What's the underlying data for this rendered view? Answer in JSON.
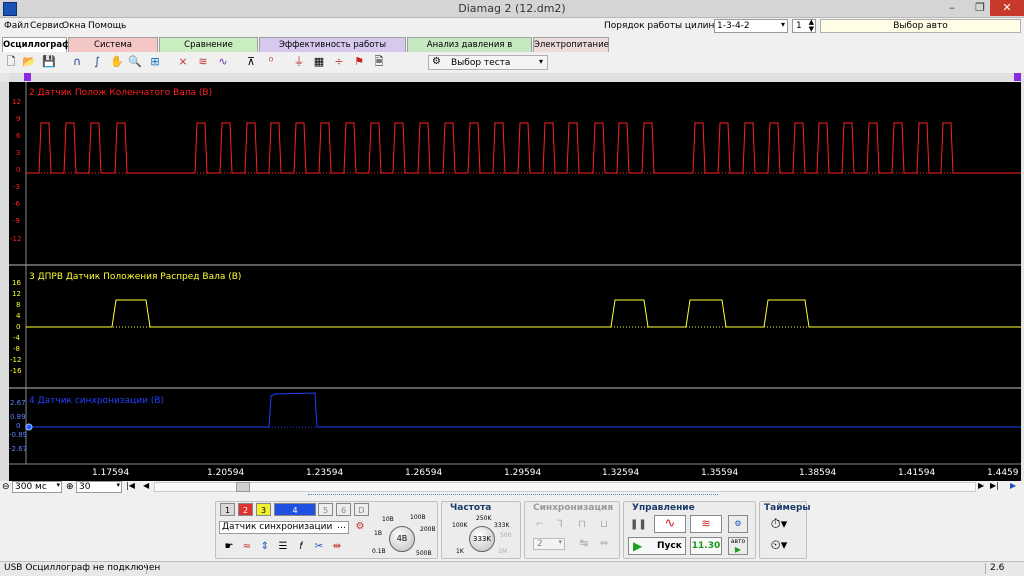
{
  "window": {
    "title": "Diamag 2 (12.dm2)",
    "min": "–",
    "max": "❐",
    "close": "✕"
  },
  "menu": [
    "Файл",
    "Сервис",
    "Окна",
    "Помощь"
  ],
  "header": {
    "order_label": "Порядок работы цилиндров",
    "order_value": "1-3-4-2",
    "cyl_value": "1",
    "auto_button": "Выбор авто"
  },
  "tabs": [
    {
      "label": "Осциллограф",
      "color": "#ffffff"
    },
    {
      "label": "Система зажигания",
      "color": "#f5c6c6"
    },
    {
      "label": "Сравнение цилиндров",
      "color": "#c9ecc0"
    },
    {
      "label": "Эффективность работы цилиндров",
      "color": "#d7c9ee"
    },
    {
      "label": "Анализ давления в цилиндре",
      "color": "#c5e8c0"
    },
    {
      "label": "Электропитание",
      "color": "#ecdcdc"
    }
  ],
  "toolbar": {
    "test_select": "Выбор теста"
  },
  "channels": [
    {
      "title": "2 Датчик Полож Коленчатого Вала (В)",
      "color": "#ff2020",
      "ticks": [
        "12",
        "9",
        "6",
        "3",
        "0",
        "-3",
        "-6",
        "-9",
        "-12"
      ]
    },
    {
      "title": "3 ДПРВ Датчик Положения Распред Вала (В)",
      "color": "#ffff30",
      "ticks": [
        "16",
        "12",
        "8",
        "4",
        "0",
        "-4",
        "-8",
        "-12",
        "-16"
      ]
    },
    {
      "title": "4 Датчик синхронизации (В)",
      "color": "#2040ff",
      "ticks": [
        "2.67",
        "0.89",
        "0",
        "-0.89",
        "-2.67"
      ]
    }
  ],
  "time_axis": [
    "1.17594",
    "1.20594",
    "1.23594",
    "1.26594",
    "1.29594",
    "1.32594",
    "1.35594",
    "1.38594",
    "1.41594",
    "1.4459"
  ],
  "scale": {
    "time": "300 мс",
    "count": "30"
  },
  "channel_buttons": [
    "1",
    "2",
    "3",
    "4",
    "5",
    "6",
    "D"
  ],
  "channel_button_colors": [
    "#d8d8d8",
    "#e03030",
    "#f0f030",
    "#2050e0",
    "#d8d8d8",
    "#d8d8d8",
    "#d8d8d8"
  ],
  "sensor_select": "Датчик синхронизации",
  "volt_knob": {
    "value": "4B",
    "labels": [
      "10B",
      "100B",
      "1B",
      "200B",
      "0.1B",
      "500B"
    ]
  },
  "freq": {
    "title": "Частота",
    "value": "333K",
    "labels": [
      "250K",
      "100K",
      "333K",
      "500",
      "1K",
      "1M"
    ]
  },
  "sync": {
    "title": "Синхронизация",
    "value": "2"
  },
  "control": {
    "title": "Управление",
    "run": "Пуск",
    "time": "11.30",
    "auto": "авто"
  },
  "timers": {
    "title": "Таймеры"
  },
  "status": {
    "text": "USB Осциллограф не подключен",
    "version": "2.6"
  }
}
